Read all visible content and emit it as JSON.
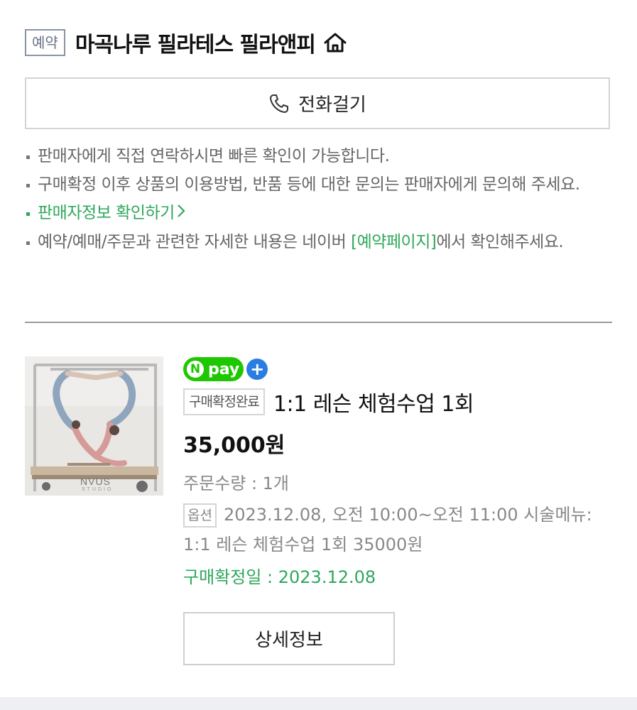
{
  "header": {
    "badge": "예약",
    "shop_name": "마곡나루 필라테스 필라앤피",
    "home_icon": "home-icon"
  },
  "call_button": {
    "label": "전화걸기",
    "icon": "phone-icon"
  },
  "notes": {
    "line1": "판매자에게 직접 연락하시면 빠른 확인이 가능합니다.",
    "line2": "구매확정 이후 상품의 이용방법, 반품 등에 대한 문의는 판매자에게 문의해 주세요.",
    "seller_link": "판매자정보 확인하기",
    "line4_prefix": "예약/예매/주문과 관련한 자세한 내용은 네이버 ",
    "line4_link": "[예약페이지]",
    "line4_suffix": "에서 확인해주세요."
  },
  "order": {
    "npay_label": "pay",
    "npay_n": "N",
    "npay_plus": "+",
    "thumb_brand": "NVUS",
    "thumb_sub": "STUDIO",
    "status": "구매확정완료",
    "product_name": "1:1 레슨 체험수업 1회",
    "price": "35,000원",
    "quantity": "주문수량 : 1개",
    "option_label": "옵션",
    "option_text": "2023.12.08, 오전 10:00~오전 11:00 시술메뉴: 1:1 레슨 체험수업 1회 35000원",
    "confirm_date": "구매확정일 : 2023.12.08",
    "detail_button": "상세정보"
  },
  "colors": {
    "accent_green": "#2ea85c",
    "npay_green": "#1ec800",
    "npay_blue": "#2a7de1"
  }
}
